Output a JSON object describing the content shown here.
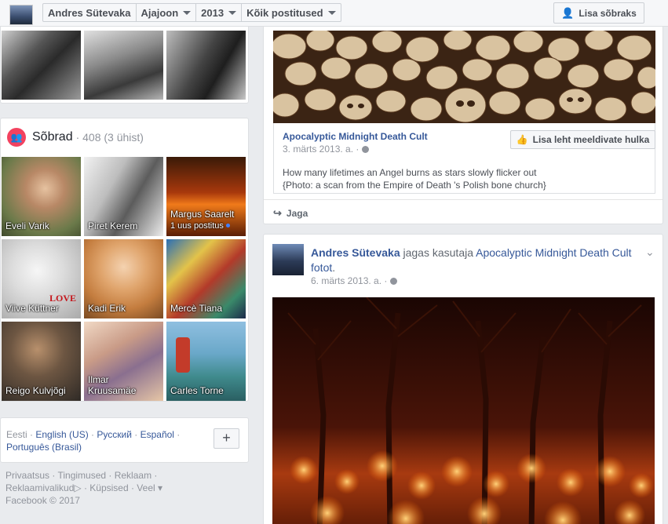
{
  "topbar": {
    "name": "Andres Sütevaka",
    "timeline": "Ajajoon",
    "year": "2013",
    "filter": "Kõik postitused",
    "add_friend": "Lisa sõbraks"
  },
  "friends": {
    "title": "Sõbrad",
    "count": "· 408 (3 ühist)",
    "items": [
      {
        "name": "Eveli Varik"
      },
      {
        "name": "Piret Kerem"
      },
      {
        "name": "Margus Saarelt",
        "sub": "1 uus postitus"
      },
      {
        "name": "Viive Küttner",
        "overlay": "LOVE"
      },
      {
        "name": "Kadi Erik"
      },
      {
        "name": "Mercè Tiana"
      },
      {
        "name": "Reigo Kulvjõgi"
      },
      {
        "name": "Ilmar Kruusamäe"
      },
      {
        "name": "Carles Torne"
      }
    ]
  },
  "languages": {
    "current": "Eesti",
    "links": [
      "English (US)",
      "Русский",
      "Español",
      "Português (Brasil)"
    ],
    "plus": "+"
  },
  "footer": {
    "line1": "Privaatsus · Tingimused · Reklaam ·",
    "line2a": "Reklaamivalikud",
    "line2b": " · Küpsised · Veel ▾",
    "line3": "Facebook © 2017"
  },
  "post1": {
    "page_name": "Apocalyptic Midnight Death Cult",
    "date": "3. märts 2013. a. ·",
    "caption_line1": "How many lifetimes an Angel burns as stars slowly flicker out",
    "caption_line2": "{Photo: a scan from the Empire of Death 's Polish bone church}",
    "like_page": "Lisa leht meeldivate hulka",
    "share": "Jaga"
  },
  "post2": {
    "author": "Andres Sütevaka",
    "verb": " jagas kasutaja ",
    "page": "Apocalyptic Midnight Death Cult",
    "photo_word": "fotot",
    "period": ".",
    "date": "6. märts 2013. a. ·"
  }
}
